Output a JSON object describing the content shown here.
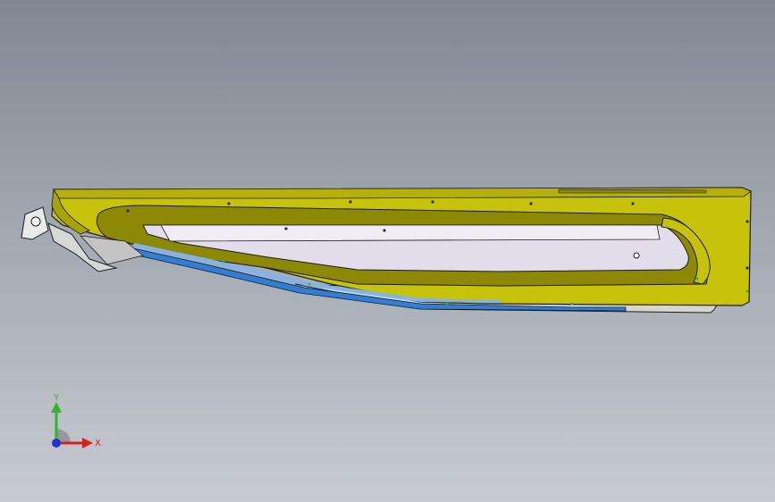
{
  "viewport": {
    "background_top": "#7f8893",
    "background_bottom": "#c7cbd1"
  },
  "model": {
    "part_colors": {
      "body": "#c7c20c",
      "body_dark": "#8f8a05",
      "inner_panel": "#e3dceb",
      "channel": "#2f7fd8",
      "edge": "#1b1b1b",
      "hinge": "#e9e9e9"
    }
  },
  "triad": {
    "y_label": "Y",
    "x_label": "X",
    "y_color": "#34b234",
    "x_color": "#d42020",
    "z_color": "#2233cc"
  }
}
